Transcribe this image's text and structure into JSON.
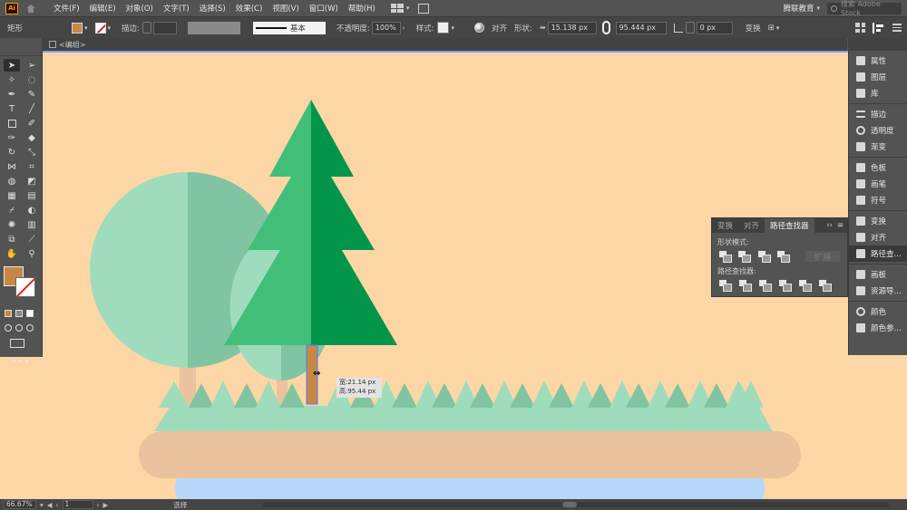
{
  "app": {
    "logo": "Ai"
  },
  "menu": [
    "文件(F)",
    "编辑(E)",
    "对象(O)",
    "文字(T)",
    "选择(S)",
    "效果(C)",
    "视图(V)",
    "窗口(W)",
    "帮助(H)"
  ],
  "workspace": "腾联教育",
  "stock_search": "搜索 Adobe Stock",
  "control": {
    "object_type": "矩形",
    "fill_color": "#c88845",
    "stroke_label": "描边:",
    "stroke_profile": "基本",
    "opacity_label": "不透明度:",
    "opacity_value": "100%",
    "style_label": "样式:",
    "align_label": "对齐",
    "shape_label": "形状:",
    "width_value": "15.138 px",
    "height_value": "95.444 px",
    "angle_value": "0 px",
    "transform_label": "变换"
  },
  "document_tab": "<编组>",
  "right_dock": {
    "group1": [
      "属性",
      "图层",
      "库"
    ],
    "group2": [
      "描边",
      "透明度",
      "渐变"
    ],
    "group3": [
      "色板",
      "画笔",
      "符号"
    ],
    "group4": [
      "变换",
      "对齐",
      "路径查..."
    ],
    "group5": [
      "画板",
      "资源导..."
    ],
    "group6": [
      "颜色",
      "颜色参..."
    ]
  },
  "pathfinder": {
    "tabs": [
      "变换",
      "对齐",
      "路径查找器"
    ],
    "shape_modes_label": "形状模式:",
    "pathfinders_label": "路径查找器:",
    "expand_label": "扩展"
  },
  "tooltip": {
    "width": "宽:21.14 px",
    "height": "高:95.44 px"
  },
  "status": {
    "zoom": "66.67%",
    "page": "1",
    "tool": "选择"
  },
  "colors": {
    "canvas": "#fdd6a5",
    "tree_light": "#41bf79",
    "tree_dark": "#03964b",
    "trunk": "#c88845",
    "round_tree_light": "#9fdcbc",
    "round_tree_dark": "#80c4a1",
    "grass": "#9fdcbc",
    "ground": "#ebc29e",
    "water": "#b6d7f9"
  }
}
